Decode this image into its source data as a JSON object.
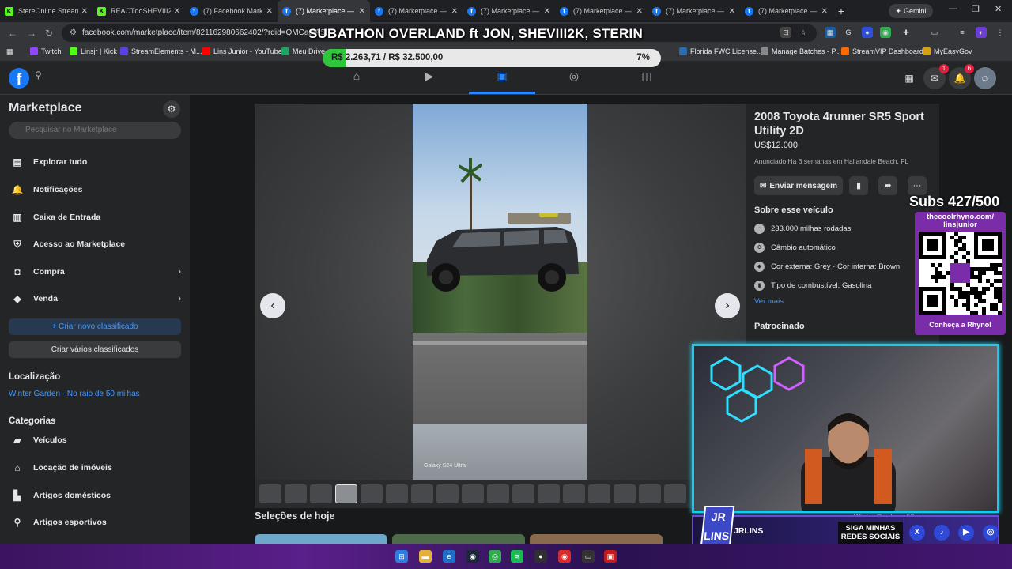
{
  "browser": {
    "tabs": [
      {
        "label": "StereOnline Stream",
        "icon": "kick-icon",
        "active": false
      },
      {
        "label": "REACTdoSHEVIII2K",
        "icon": "kick-icon",
        "active": false
      },
      {
        "label": "(7) Facebook Marke",
        "icon": "facebook-icon",
        "active": false
      },
      {
        "label": "(7) Marketplace —",
        "icon": "facebook-icon",
        "active": true
      },
      {
        "label": "(7) Marketplace —",
        "icon": "facebook-icon",
        "active": false
      },
      {
        "label": "(7) Marketplace —",
        "icon": "facebook-icon",
        "active": false
      },
      {
        "label": "(7) Marketplace —",
        "icon": "facebook-icon",
        "active": false
      },
      {
        "label": "(7) Marketplace —",
        "icon": "facebook-icon",
        "active": false
      },
      {
        "label": "(7) Marketplace —",
        "icon": "facebook-icon",
        "active": false
      }
    ],
    "gemini_label": "Gemini",
    "url": "facebook.com/marketplace/item/821162980662402/?rdid=QMCaglAS",
    "bookmarks": [
      {
        "label": "Twitch",
        "color": "#9146ff"
      },
      {
        "label": "Linsjr | Kick",
        "color": "#53fc18"
      },
      {
        "label": "StreamElements - M...",
        "color": "#5a3ee6"
      },
      {
        "label": "Lins Junior - YouTube",
        "color": "#ff0000"
      },
      {
        "label": "Meu Drive",
        "color": "#1fa463"
      },
      {
        "label": "Florida FWC License...",
        "color": "#2b6cb0"
      },
      {
        "label": "Manage Batches - P...",
        "color": "#888888"
      },
      {
        "label": "StreamVIP Dashboard",
        "color": "#ff6a00"
      },
      {
        "label": "MyEasyGov",
        "color": "#d4a017"
      }
    ]
  },
  "fb": {
    "logo": "f",
    "notifications_count": "6",
    "messages_count": "1"
  },
  "sidebar": {
    "title": "Marketplace",
    "search_placeholder": "Pesquisar no Marketplace",
    "items": [
      {
        "label": "Explorar tudo",
        "icon": "storefront-icon",
        "chevron": false
      },
      {
        "label": "Notificações",
        "icon": "bell-icon",
        "chevron": false
      },
      {
        "label": "Caixa de Entrada",
        "icon": "inbox-icon",
        "chevron": false
      },
      {
        "label": "Acesso ao Marketplace",
        "icon": "shield-icon",
        "chevron": false
      },
      {
        "label": "Compra",
        "icon": "shopping-bag-icon",
        "chevron": true
      },
      {
        "label": "Venda",
        "icon": "tag-icon",
        "chevron": true
      }
    ],
    "create_listing": "Criar novo classificado",
    "create_multiple": "Criar vários classificados",
    "location_heading": "Localização",
    "location_value": "Winter Garden · No raio de 50 milhas",
    "categories_heading": "Categorias",
    "categories": [
      {
        "label": "Veículos",
        "icon": "car-icon"
      },
      {
        "label": "Locação de imóveis",
        "icon": "house-icon"
      },
      {
        "label": "Artigos domésticos",
        "icon": "armchair-icon"
      },
      {
        "label": "Artigos esportivos",
        "icon": "running-icon"
      }
    ]
  },
  "viewer": {
    "watermark": "Galaxy S24 Ultra",
    "thumb_count": 17,
    "active_thumb_index": 3
  },
  "listing": {
    "title": "2008 Toyota 4runner SR5 Sport Utility 2D",
    "price": "US$12.000",
    "listed": "Anunciado Há 6 semanas em Hallandale Beach, FL",
    "send_message": "Enviar mensagem",
    "about_heading": "Sobre esse veículo",
    "attributes": [
      {
        "label": "233.000 milhas rodadas",
        "icon": "speedometer-icon"
      },
      {
        "label": "Câmbio automático",
        "icon": "gearbox-icon"
      },
      {
        "label": "Cor externa: Grey · Cor interna: Brown",
        "icon": "paint-icon"
      },
      {
        "label": "Tipo de combustível: Gasolina",
        "icon": "fuel-icon"
      }
    ],
    "see_more": "Ver mais",
    "sponsored": "Patrocinado"
  },
  "today": {
    "title": "Seleções de hoje"
  },
  "overlay": {
    "title": "SUBATHON OVERLAND ft JON, SHEVIII2K, STERIN",
    "progress_text": "R$ 2.263,71 / R$ 32.500,00",
    "progress_pct_label": "7%",
    "progress_fraction": 0.07,
    "subs": "Subs 427/500",
    "qr_url": "thecoolrhyno.com/ linsjunior",
    "qr_caption": "Conheça a Rhynol",
    "cam_location": "Winter Garden · 50 mi",
    "brand_logo": "JR LINS",
    "brand_name": "JRLINS",
    "social_cta": "SIGA MINHAS REDES SOCIAIS"
  }
}
